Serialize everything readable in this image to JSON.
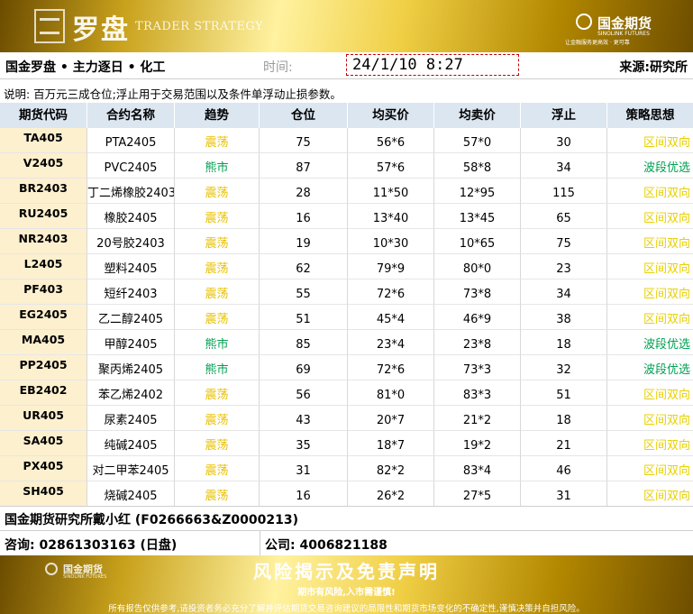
{
  "header": {
    "logo_cn": "罗盘",
    "logo_en": "TRADER STRATEGY",
    "brand_name": "国金期货",
    "brand_sub": "SINOLINK FUTURES",
    "brand_slogan": "让金融服务更高效 · 更可靠"
  },
  "info": {
    "title": "国金罗盘 • 主力逐日 • 化工",
    "time_label": "时间:",
    "time": "24/1/10  8:27",
    "source": "来源:研究所"
  },
  "note": "说明: 百万元三成仓位;浮止用于交易范围以及条件单浮动止损参数。",
  "table": {
    "columns": [
      "期货代码",
      "合约名称",
      "趋势",
      "仓位",
      "均买价",
      "均卖价",
      "浮止",
      "策略思想"
    ],
    "rows": [
      {
        "code": "TA405",
        "name": "PTA2405",
        "trend": "震荡",
        "position": "75",
        "buy": "56*6",
        "sell": "57*0",
        "stop": "30",
        "strategy": "区间双向"
      },
      {
        "code": "V2405",
        "name": "PVC2405",
        "trend": "熊市",
        "position": "87",
        "buy": "57*6",
        "sell": "58*8",
        "stop": "34",
        "strategy": "波段优选"
      },
      {
        "code": "BR2403",
        "name": "丁二烯橡胶2403",
        "trend": "震荡",
        "position": "28",
        "buy": "11*50",
        "sell": "12*95",
        "stop": "115",
        "strategy": "区间双向"
      },
      {
        "code": "RU2405",
        "name": "橡胶2405",
        "trend": "震荡",
        "position": "16",
        "buy": "13*40",
        "sell": "13*45",
        "stop": "65",
        "strategy": "区间双向"
      },
      {
        "code": "NR2403",
        "name": "20号胶2403",
        "trend": "震荡",
        "position": "19",
        "buy": "10*30",
        "sell": "10*65",
        "stop": "75",
        "strategy": "区间双向"
      },
      {
        "code": "L2405",
        "name": "塑料2405",
        "trend": "震荡",
        "position": "62",
        "buy": "79*9",
        "sell": "80*0",
        "stop": "23",
        "strategy": "区间双向"
      },
      {
        "code": "PF403",
        "name": "短纤2403",
        "trend": "震荡",
        "position": "55",
        "buy": "72*6",
        "sell": "73*8",
        "stop": "34",
        "strategy": "区间双向"
      },
      {
        "code": "EG2405",
        "name": "乙二醇2405",
        "trend": "震荡",
        "position": "51",
        "buy": "45*4",
        "sell": "46*9",
        "stop": "38",
        "strategy": "区间双向"
      },
      {
        "code": "MA405",
        "name": "甲醇2405",
        "trend": "熊市",
        "position": "85",
        "buy": "23*4",
        "sell": "23*8",
        "stop": "18",
        "strategy": "波段优选"
      },
      {
        "code": "PP2405",
        "name": "聚丙烯2405",
        "trend": "熊市",
        "position": "69",
        "buy": "72*6",
        "sell": "73*3",
        "stop": "32",
        "strategy": "波段优选"
      },
      {
        "code": "EB2402",
        "name": "苯乙烯2402",
        "trend": "震荡",
        "position": "56",
        "buy": "81*0",
        "sell": "83*3",
        "stop": "51",
        "strategy": "区间双向"
      },
      {
        "code": "UR405",
        "name": "尿素2405",
        "trend": "震荡",
        "position": "43",
        "buy": "20*7",
        "sell": "21*2",
        "stop": "18",
        "strategy": "区间双向"
      },
      {
        "code": "SA405",
        "name": "纯碱2405",
        "trend": "震荡",
        "position": "35",
        "buy": "18*7",
        "sell": "19*2",
        "stop": "21",
        "strategy": "区间双向"
      },
      {
        "code": "PX405",
        "name": "对二甲苯2405",
        "trend": "震荡",
        "position": "31",
        "buy": "82*2",
        "sell": "83*4",
        "stop": "46",
        "strategy": "区间双向"
      },
      {
        "code": "SH405",
        "name": "烧碱2405",
        "trend": "震荡",
        "position": "16",
        "buy": "26*2",
        "sell": "27*5",
        "stop": "31",
        "strategy": "区间双向"
      }
    ]
  },
  "footer": {
    "author": "国金期货研究所戴小红 (F0266663&Z0000213)",
    "consult": "咨询: 02861303163 (日盘)",
    "company": "公司: 4006821188"
  },
  "bottom": {
    "logo": "国金期货",
    "logo_sub": "SINOLINK FUTURES",
    "title": "风险揭示及免责声明",
    "slogan": "期市有风险,入市需谨慎!",
    "disclaimer": "所有报告仅供参考,请投资者务必充分了解并评估期货交易咨询建议的局限性和期货市场变化的不确定性,谨慎决策并自担风险。"
  },
  "colors": {
    "trend_oscillation": "#e8c000",
    "trend_bear": "#00a050",
    "header_bg": "#dce6f1",
    "code_bg": "#fdf0cf"
  }
}
